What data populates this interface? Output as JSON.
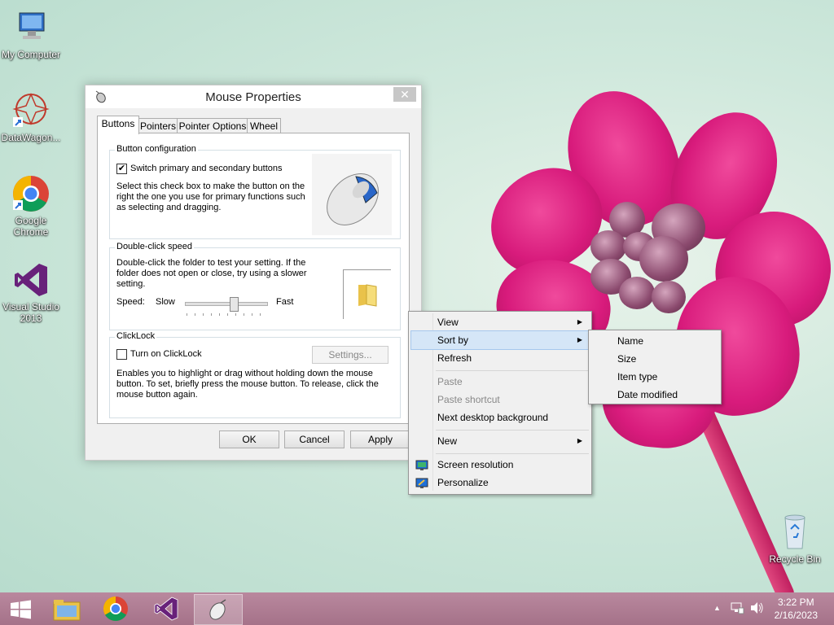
{
  "desktop": {
    "icons": [
      {
        "label": "My Computer"
      },
      {
        "label": "DataWagon..."
      },
      {
        "label": "Google Chrome"
      },
      {
        "label": "Visual Studio 2013"
      },
      {
        "label": "Recycle Bin"
      }
    ]
  },
  "window": {
    "title": "Mouse Properties",
    "tabs": [
      "Buttons",
      "Pointers",
      "Pointer Options",
      "Wheel"
    ],
    "button_config": {
      "group_label": "Button configuration",
      "checkbox_label": "Switch primary and secondary buttons",
      "checked": true,
      "description": "Select this check box to make the button on the right the one you use for primary functions such as selecting and dragging."
    },
    "double_click": {
      "group_label": "Double-click speed",
      "description": "Double-click the folder to test your setting. If the folder does not open or close, try using a slower setting.",
      "speed_label": "Speed:",
      "slow_label": "Slow",
      "fast_label": "Fast",
      "speed_value": 0.6
    },
    "clicklock": {
      "group_label": "ClickLock",
      "checkbox_label": "Turn on ClickLock",
      "checked": false,
      "settings_button": "Settings...",
      "description": "Enables you to highlight or drag without holding down the mouse button. To set, briefly press the mouse button. To release, click the mouse button again."
    },
    "buttons": {
      "ok": "OK",
      "cancel": "Cancel",
      "apply": "Apply"
    }
  },
  "context_menu": {
    "items": [
      {
        "label": "View"
      },
      {
        "label": "Sort by"
      },
      {
        "label": "Refresh"
      },
      {
        "label": "Paste"
      },
      {
        "label": "Paste shortcut"
      },
      {
        "label": "Next desktop background"
      },
      {
        "label": "New"
      },
      {
        "label": "Screen resolution"
      },
      {
        "label": "Personalize"
      }
    ],
    "submenu": [
      "Name",
      "Size",
      "Item type",
      "Date modified"
    ]
  },
  "taskbar": {
    "time": "3:22 PM",
    "date": "2/16/2023"
  },
  "colors": {
    "taskbar": "#a57289",
    "menu_highlight": "#d5e6f7",
    "petal": "#d81b7c"
  }
}
